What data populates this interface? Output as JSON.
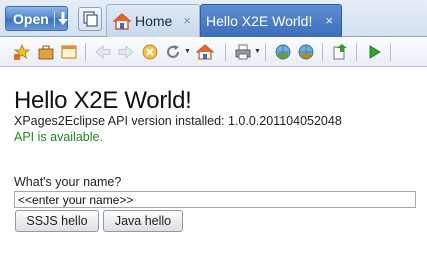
{
  "tabbar": {
    "open_label": "Open",
    "tabs": [
      {
        "label": "Home",
        "icon": "home-icon",
        "close": "×",
        "active": false
      },
      {
        "label": "Hello X2E World!",
        "icon": "",
        "close": "×",
        "active": true
      }
    ]
  },
  "toolbar": {
    "icons": [
      "bookmark-star-icon",
      "briefcase-icon",
      "window-icon",
      "back-arrow-icon",
      "forward-arrow-icon",
      "stop-icon",
      "refresh-icon",
      "home-icon",
      "print-icon",
      "globe-icon",
      "globe-alt-icon",
      "export-icon",
      "play-icon"
    ]
  },
  "page": {
    "title": "Hello X2E World!",
    "version_line": "XPages2Eclipse API version installed: 1.0.0.201104052048",
    "api_status": "API is available.",
    "name_label": "What's your name?",
    "name_value": "<<enter your name>>",
    "ssjs_button": "SSJS hello",
    "java_button": "Java hello"
  },
  "colors": {
    "active_tab": "#3b6dbb",
    "api_status": "#1e8a1e"
  }
}
